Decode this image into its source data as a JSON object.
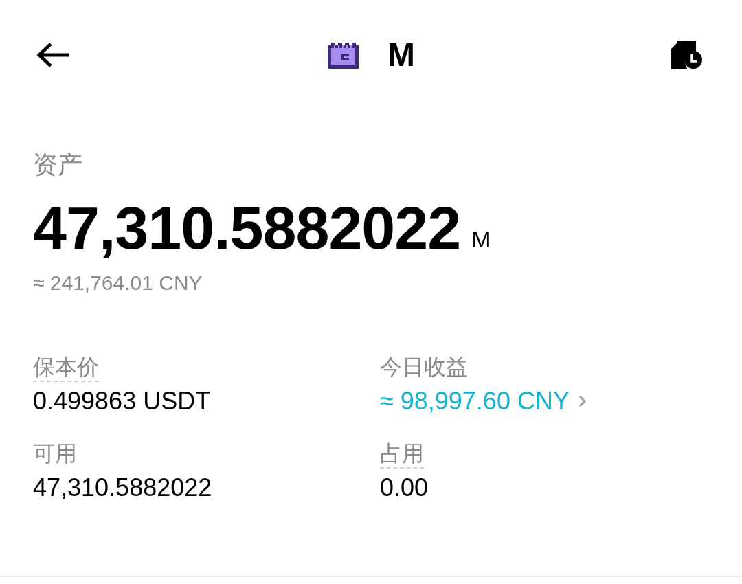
{
  "header": {
    "title": "M"
  },
  "assets": {
    "label": "资产",
    "amount": "47,310.5882022",
    "unit": "M",
    "approx": "≈ 241,764.01 CNY"
  },
  "stats": [
    {
      "label": "保本价",
      "value": "0.499863 USDT",
      "underlined": true,
      "linked": false
    },
    {
      "label": "今日收益",
      "value": "≈ 98,997.60 CNY",
      "underlined": false,
      "linked": true
    },
    {
      "label": "可用",
      "value": "47,310.5882022",
      "underlined": false,
      "linked": false
    },
    {
      "label": "占用",
      "value": "0.00",
      "underlined": true,
      "linked": false
    }
  ]
}
